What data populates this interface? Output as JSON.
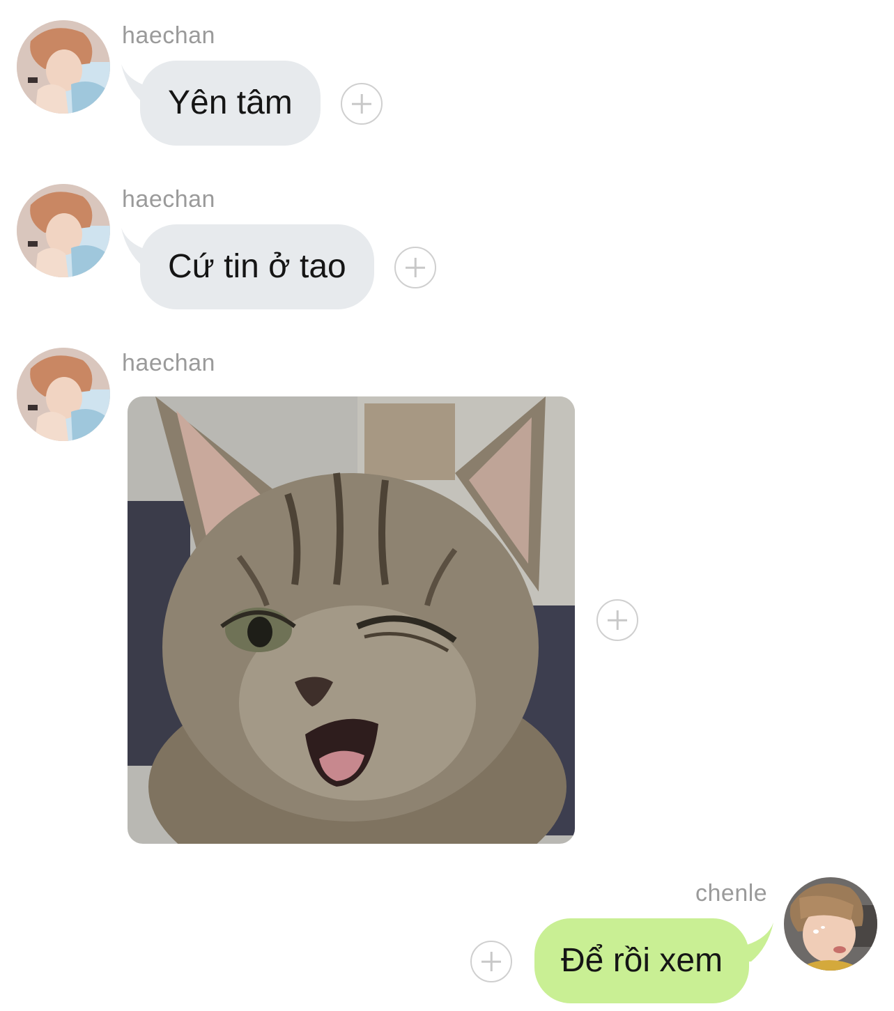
{
  "messages": [
    {
      "sender": "haechan",
      "avatar": "haechan-avatar-photo",
      "type": "text",
      "text": "Yên tâm",
      "direction": "incoming"
    },
    {
      "sender": "haechan",
      "avatar": "haechan-avatar-photo",
      "type": "text",
      "text": "Cứ tin ở tao",
      "direction": "incoming"
    },
    {
      "sender": "haechan",
      "avatar": "haechan-avatar-photo",
      "type": "image",
      "image": "winking-kitten-photo",
      "direction": "incoming"
    },
    {
      "sender": "chenle",
      "avatar": "chenle-avatar-photo",
      "type": "text",
      "text": "Để rồi xem",
      "direction": "outgoing"
    }
  ],
  "icons": {
    "add_reaction": "plus-circle-icon"
  },
  "colors": {
    "background": "#ffffff",
    "incoming_bubble": "#e7eaed",
    "outgoing_bubble": "#c9ef94",
    "sender_name": "#9a9a9a",
    "message_text": "#151515",
    "add_button": "#cfcfcf"
  }
}
